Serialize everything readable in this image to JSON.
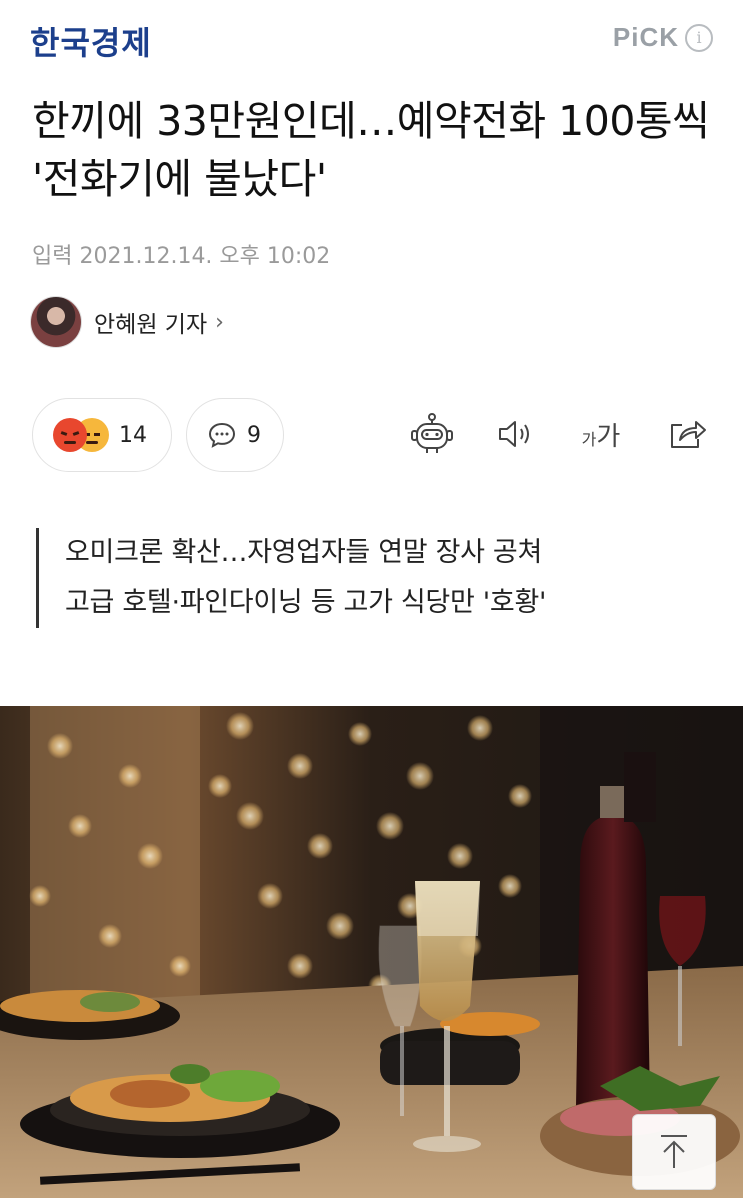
{
  "header": {
    "logo": "한국경제",
    "pick_label": "PiCK",
    "info_glyph": "i"
  },
  "article": {
    "headline": "한끼에 33만원인데…예약전화 100통씩 '전화기에 불났다'",
    "date": "입력 2021.12.14. 오후 10:02",
    "reporter": "안혜원 기자",
    "reporter_chevron": "›"
  },
  "actions": {
    "reaction_count": "14",
    "comment_count": "9",
    "font_size_small": "가",
    "font_size_large": "가"
  },
  "subhead": {
    "lines": [
      "오미크론 확산…자영업자들 연말 장사 공쳐",
      "고급 호텔·파인다이닝 등 고가 식당만 '호황'"
    ]
  },
  "colors": {
    "logo": "#1c3f8c",
    "pick": "#9aa0a6",
    "angry_emoji": "#e8472e",
    "sad_emoji": "#f6b73c"
  },
  "icons": [
    "info-icon",
    "chevron-right-icon",
    "angry-emoji-icon",
    "sad-emoji-icon",
    "comment-icon",
    "robot-summary-icon",
    "speaker-icon",
    "font-size-icon",
    "share-icon",
    "scroll-top-icon"
  ]
}
